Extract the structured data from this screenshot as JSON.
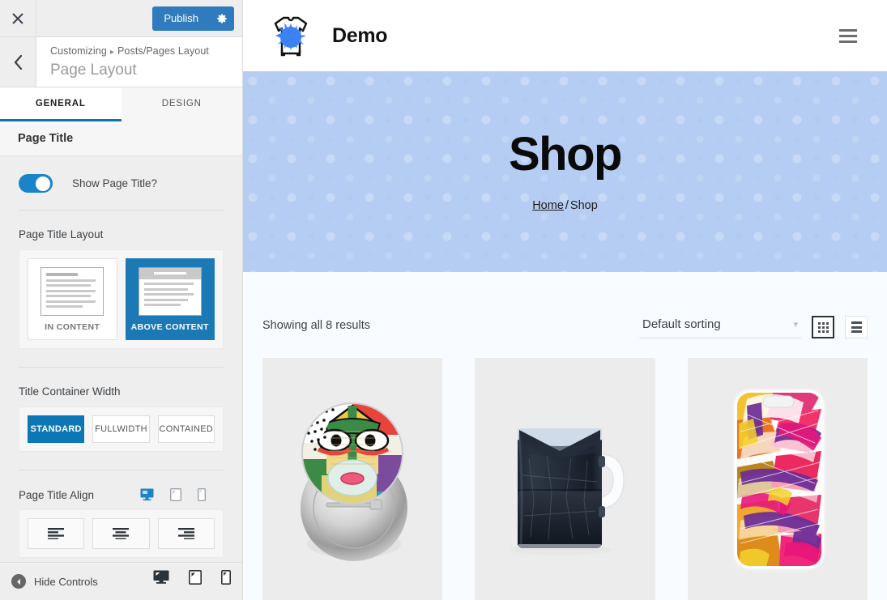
{
  "customizer": {
    "close_label": "Close",
    "publish_label": "Publish",
    "gear_label": "Publish Settings",
    "back_label": "Back",
    "breadcrumb": {
      "root": "Customizing",
      "separator": "▸",
      "parent": "Posts/Pages Layout"
    },
    "panel_title": "Page Layout",
    "tabs": [
      {
        "label": "GENERAL",
        "active": true
      },
      {
        "label": "DESIGN",
        "active": false
      }
    ],
    "section_title": "Page Title",
    "controls": {
      "show_page_title": {
        "label": "Show Page Title?",
        "value": "on"
      },
      "page_title_layout": {
        "label": "Page Title Layout",
        "options": [
          {
            "label": "IN CONTENT",
            "selected": false
          },
          {
            "label": "ABOVE CONTENT",
            "selected": true
          }
        ]
      },
      "title_container_width": {
        "label": "Title Container Width",
        "options": [
          {
            "label": "STANDARD",
            "selected": true
          },
          {
            "label": "FULLWIDTH",
            "selected": false
          },
          {
            "label": "CONTAINED",
            "selected": false
          }
        ]
      },
      "page_title_align": {
        "label": "Page Title Align",
        "devices": [
          {
            "name": "desktop-icon",
            "active": true
          },
          {
            "name": "tablet-icon",
            "active": false
          },
          {
            "name": "mobile-icon",
            "active": false
          }
        ],
        "options": [
          {
            "name": "align-left-icon",
            "selected": false
          },
          {
            "name": "align-center-icon",
            "selected": false
          },
          {
            "name": "align-right-icon",
            "selected": false
          }
        ]
      }
    },
    "footer": {
      "hide_controls_label": "Hide Controls",
      "devices": [
        {
          "name": "desktop-icon",
          "active": true
        },
        {
          "name": "tablet-icon",
          "active": false
        },
        {
          "name": "mobile-icon",
          "active": false
        }
      ]
    },
    "colors": {
      "accent": "#0d77b5",
      "publish": "#2f7bbd",
      "toggle_on": "#1b84c8",
      "tab_underline": "#0e75ad"
    }
  },
  "preview": {
    "header": {
      "brand": "Demo",
      "logo_name": "tshirt-logo-icon",
      "menu_name": "hamburger-menu-icon"
    },
    "hero": {
      "title": "Shop",
      "breadcrumb_home": "Home",
      "breadcrumb_slash": "/",
      "breadcrumb_current": "Shop",
      "background_color": "#b5cdf2"
    },
    "shop": {
      "result_count": "Showing all 8 results",
      "sorting_value": "Default sorting",
      "views": [
        {
          "name": "grid-view-icon",
          "active": true
        },
        {
          "name": "list-view-icon",
          "active": false
        }
      ],
      "products": [
        {
          "name": "pin-badge-product",
          "alt": "Colorful face art pin badge"
        },
        {
          "name": "mug-product",
          "alt": "Dark navy ceramic mug with white handle"
        },
        {
          "name": "phone-case-product",
          "alt": "Abstract paint phone case"
        }
      ]
    }
  }
}
